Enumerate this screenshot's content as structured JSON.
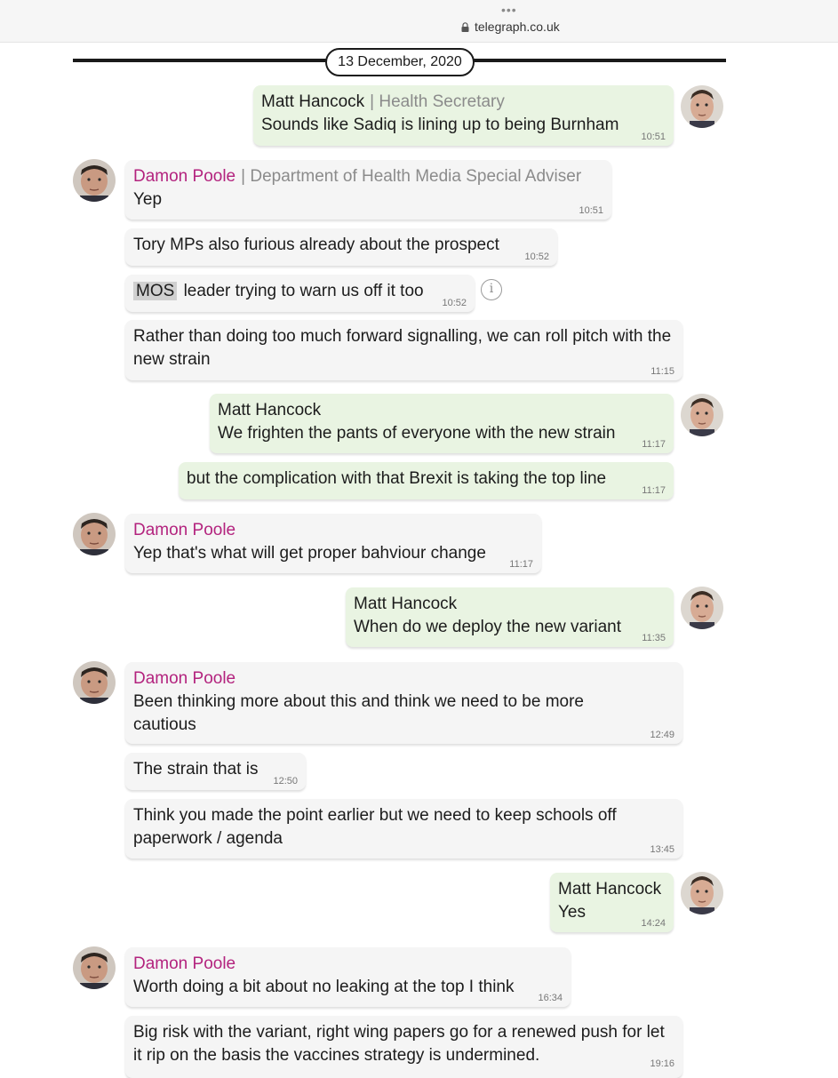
{
  "browser": {
    "url": "telegraph.co.uk",
    "menu_dots": "•••"
  },
  "chat": {
    "date": "13 December, 2020",
    "info_glyph": "i",
    "messages": [
      {
        "sender": "Matt Hancock",
        "role": "Health Secretary",
        "text": "Sounds like Sadiq is lining up to being Burnham",
        "time": "10:51"
      },
      {
        "sender": "Damon Poole",
        "role": "Department of Health Media Special Adviser",
        "text": "Yep",
        "time": "10:51"
      },
      {
        "text": "Tory MPs also furious already about the prospect",
        "time": "10:52"
      },
      {
        "tag": "MOS",
        "text": "leader trying to warn us off it too",
        "time": "10:52"
      },
      {
        "text": "Rather than doing too much forward signalling, we can roll pitch with the new strain",
        "time": "11:15"
      },
      {
        "sender": "Matt Hancock",
        "text": "We frighten the pants of everyone with the new strain",
        "time": "11:17"
      },
      {
        "text": "but the complication with that Brexit is taking the top line",
        "time": "11:17"
      },
      {
        "sender": "Damon Poole",
        "text": "Yep that's what will get proper bahviour change",
        "time": "11:17"
      },
      {
        "sender": "Matt Hancock",
        "text": "When do we deploy the new variant",
        "time": "11:35"
      },
      {
        "sender": "Damon Poole",
        "text": "Been thinking more about this and think we need to be more cautious",
        "time": "12:49"
      },
      {
        "text": "The strain that is",
        "time": "12:50"
      },
      {
        "text": "Think you made the point earlier but we need to keep schools off paperwork / agenda",
        "time": "13:45"
      },
      {
        "sender": "Matt Hancock",
        "text": "Yes",
        "time": "14:24"
      },
      {
        "sender": "Damon Poole",
        "text": "Worth doing a bit about no leaking at the top I think",
        "time": "16:34"
      },
      {
        "text": "Big risk with the variant, right wing papers go for a renewed push for let it rip on the basis the vaccines strategy is undermined.",
        "time": "19:16"
      }
    ]
  },
  "colors": {
    "incoming_bubble": "#f5f5f5",
    "outgoing_bubble": "#e9f4e2",
    "damon_name": "#b3237e",
    "role_text": "#8b8b8b"
  }
}
